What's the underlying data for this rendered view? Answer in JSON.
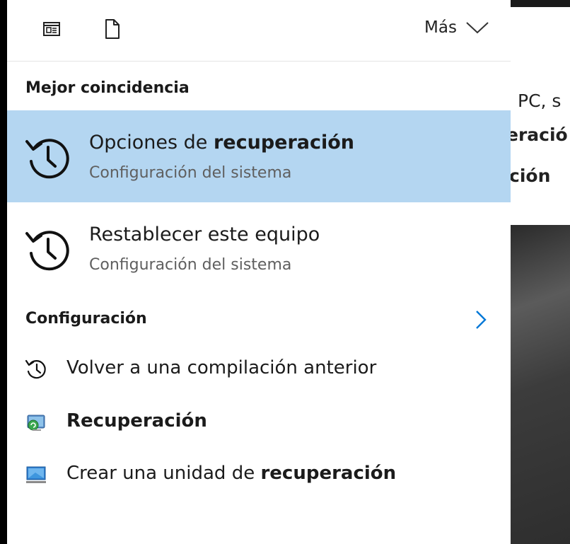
{
  "background": {
    "line1": "PC, s",
    "line2": "eració",
    "line3": "ción"
  },
  "toolbar": {
    "more_label": "Más",
    "icons": [
      "document-view-icon",
      "file-icon",
      "chevron-down-icon"
    ]
  },
  "best_match": {
    "heading": "Mejor coincidencia",
    "results": [
      {
        "title_prefix": "Opciones de ",
        "title_bold": "recuperación",
        "subtitle": "Configuración del sistema",
        "icon": "history-clock-icon",
        "selected": true
      },
      {
        "title_prefix": "Restablecer este equipo",
        "title_bold": "",
        "subtitle": "Configuración del sistema",
        "icon": "history-clock-icon",
        "selected": false
      }
    ]
  },
  "settings": {
    "heading": "Configuración",
    "items": [
      {
        "prefix": "Volver a una compilación anterior",
        "bold": "",
        "icon": "history-clock-icon"
      },
      {
        "prefix": "",
        "bold": "Recuperación",
        "icon": "recovery-control-panel-icon"
      },
      {
        "prefix": "Crear una unidad de ",
        "bold": "recuperación",
        "icon": "monitor-icon"
      }
    ]
  },
  "colors": {
    "selected_bg": "#b4d6f1",
    "accent": "#0078d7"
  }
}
